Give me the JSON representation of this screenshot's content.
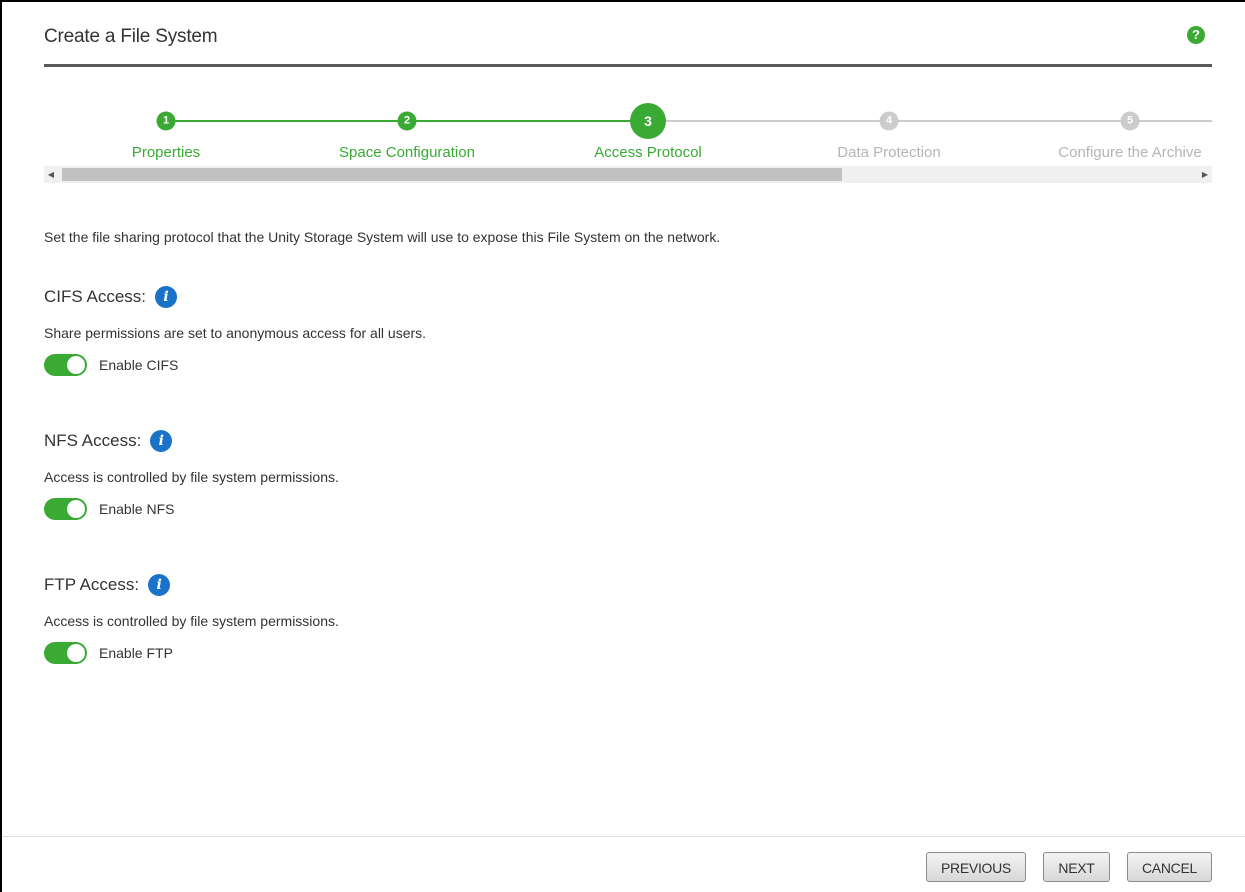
{
  "dialog": {
    "title": "Create a File System",
    "help_icon": "question-icon",
    "help_glyph": "?"
  },
  "stepper": {
    "active_color": "#3aaa35",
    "inactive_color": "#cccccc",
    "steps": [
      {
        "number": "1",
        "label": "Properties",
        "state": "done"
      },
      {
        "number": "2",
        "label": "Space Configuration",
        "state": "done"
      },
      {
        "number": "3",
        "label": "Access Protocol",
        "state": "current"
      },
      {
        "number": "4",
        "label": "Data Protection",
        "state": "pending"
      },
      {
        "number": "5",
        "label": "Configure the Archive",
        "state": "pending"
      }
    ]
  },
  "intro": "Set the file sharing protocol that the Unity Storage System will use to expose this File System on the network.",
  "sections": [
    {
      "heading": "CIFS Access:",
      "description": "Share permissions are set to anonymous access for all users.",
      "toggle_label": "Enable CIFS",
      "enabled": true
    },
    {
      "heading": "NFS Access:",
      "description": "Access is controlled by file system permissions.",
      "toggle_label": "Enable NFS",
      "enabled": true
    },
    {
      "heading": "FTP Access:",
      "description": "Access is controlled by file system permissions.",
      "toggle_label": "Enable FTP",
      "enabled": true
    }
  ],
  "info_glyph": "i",
  "buttons": {
    "previous": "PREVIOUS",
    "next": "NEXT",
    "cancel": "CANCEL"
  },
  "colors": {
    "accent_green": "#3aaa35",
    "info_blue": "#1a73c8"
  }
}
